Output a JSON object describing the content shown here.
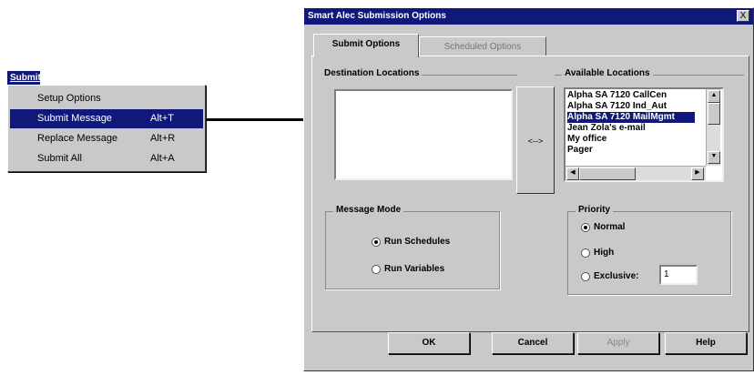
{
  "menu": {
    "title": "Submit",
    "items": [
      {
        "label": "Setup Options",
        "accel": ""
      },
      {
        "label": "Submit Message",
        "accel": "Alt+T"
      },
      {
        "label": "Replace Message",
        "accel": "Alt+R"
      },
      {
        "label": "Submit All",
        "accel": "Alt+A"
      }
    ],
    "selected_index": 1
  },
  "dialog": {
    "title": "Smart Alec Submission Options",
    "close_label": "X",
    "tabs": [
      {
        "label": "Submit Options",
        "active": true
      },
      {
        "label": "Scheduled Options",
        "active": false
      }
    ],
    "destination": {
      "label": "Destination Locations",
      "items": []
    },
    "move_button_label": "<-->",
    "available": {
      "label": "Available Locations",
      "items": [
        "Alpha SA 7120 CallCen",
        "Alpha SA 7120 Ind_Aut",
        "Alpha SA 7120 MailMgmt",
        "Jean Zola's e-mail",
        "My office",
        "Pager"
      ],
      "selected_index": 2
    },
    "message_mode": {
      "label": "Message Mode",
      "options": [
        "Run Schedules",
        "Run Variables"
      ],
      "selected_index": 0
    },
    "priority": {
      "label": "Priority",
      "options": [
        "Normal",
        "High",
        "Exclusive:"
      ],
      "selected_index": 0,
      "exclusive_value": "1"
    },
    "buttons": {
      "ok": "OK",
      "cancel": "Cancel",
      "apply": "Apply",
      "help": "Help"
    }
  },
  "colors": {
    "selection": "#10197a",
    "face": "#c9c9c9"
  }
}
